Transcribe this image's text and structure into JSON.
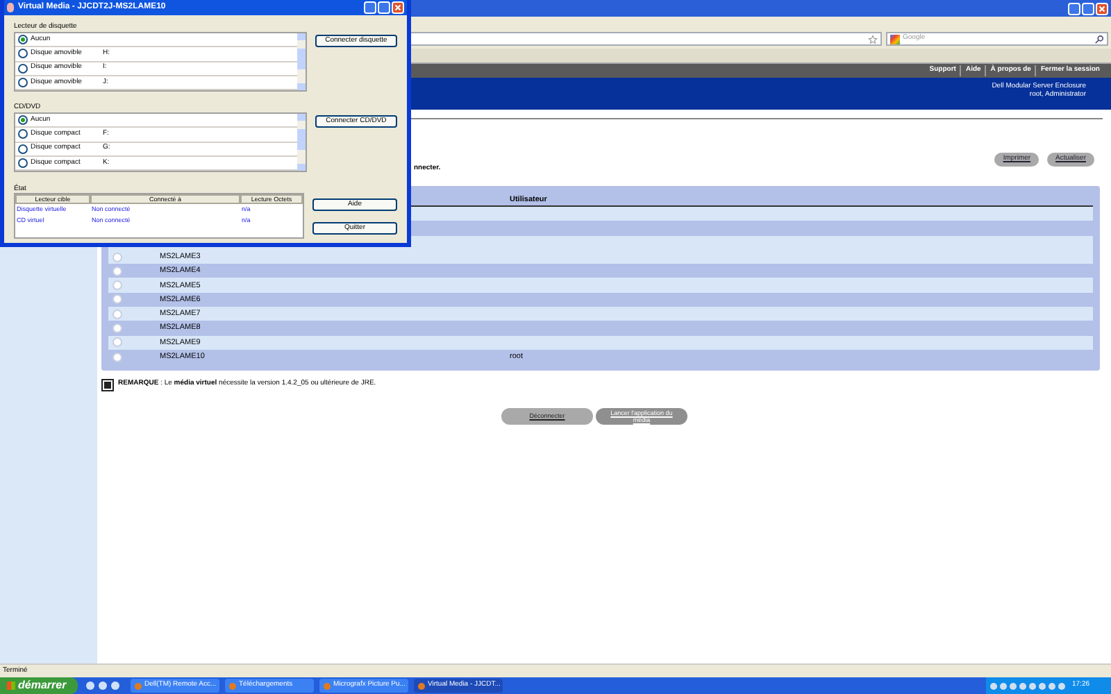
{
  "browser": {
    "nav_links": [
      "Support",
      "Aide",
      "À propos de",
      "Fermer la session"
    ],
    "search": {
      "placeholder": "Google"
    },
    "header": {
      "lines": [
        "Dell Modular Server Enclosure",
        "root, Administrator"
      ]
    }
  },
  "content": {
    "instruction": "nnecter.",
    "actions": [
      "Imprimer",
      "Actualiser"
    ],
    "table": {
      "columns": [
        "Utilisateur"
      ],
      "rows": [
        {
          "name": "MS2LAME3",
          "selected": false
        },
        {
          "name": "MS2LAME4",
          "selected": false
        },
        {
          "name": "MS2LAME5",
          "selected": false
        },
        {
          "name": "MS2LAME6",
          "selected": false
        },
        {
          "name": "MS2LAME7",
          "selected": false
        },
        {
          "name": "MS2LAME8",
          "selected": false
        },
        {
          "name": "MS2LAME9",
          "selected": false
        },
        {
          "name": "MS2LAME10",
          "user": "root",
          "selected": false
        }
      ]
    },
    "note": "**REMARQUE** : Le **média virtuel** nécessite la version 1.4.2_05 ou ultérieure de JRE.",
    "buttons": [
      {
        "label": "Déconnecter",
        "disabled": false
      },
      {
        "label": "Lancer l'application du média",
        "disabled": true
      }
    ]
  },
  "status_bar": "Terminé",
  "taskbar": {
    "start": "démarrer",
    "tasks": [
      {
        "label": "Dell(TM) Remote Acc...",
        "selected": false
      },
      {
        "label": "Téléchargements",
        "selected": false
      },
      {
        "label": "Micrografx Picture Pu...",
        "selected": false
      },
      {
        "label": "Virtual Media - JJCDT...",
        "selected": true
      }
    ],
    "clock": "17:26"
  },
  "dialog": {
    "title": "Virtual Media - JJCDT2J-MS2LAME10",
    "groups": [
      {
        "label": "Lecteur de disquette",
        "button": "Connecter disquette",
        "items": [
          {
            "label": "Aucun",
            "selected": true
          },
          {
            "label": "Disque amovible",
            "drive": "H:",
            "selected": false
          },
          {
            "label": "Disque amovible",
            "drive": "I:",
            "selected": false
          },
          {
            "label": "Disque amovible",
            "drive": "J:",
            "selected": false
          }
        ]
      },
      {
        "label": "CD/DVD",
        "button": "Connecter CD/DVD",
        "items": [
          {
            "label": "Aucun",
            "selected": true
          },
          {
            "label": "Disque compact",
            "drive": "F:",
            "selected": false
          },
          {
            "label": "Disque compact",
            "drive": "G:",
            "selected": false
          },
          {
            "label": "Disque compact",
            "drive": "K:",
            "selected": false
          }
        ]
      }
    ],
    "status": {
      "label": "État",
      "columns": [
        "Lecteur cible",
        "Connecté à",
        "Lecture Octets"
      ],
      "rows": [
        [
          "Disquette virtuelle",
          "Non connecté",
          "n/a"
        ],
        [
          "CD virtuel",
          "Non connecté",
          "n/a"
        ]
      ]
    },
    "buttons": [
      "Aide",
      "Quitter"
    ]
  }
}
